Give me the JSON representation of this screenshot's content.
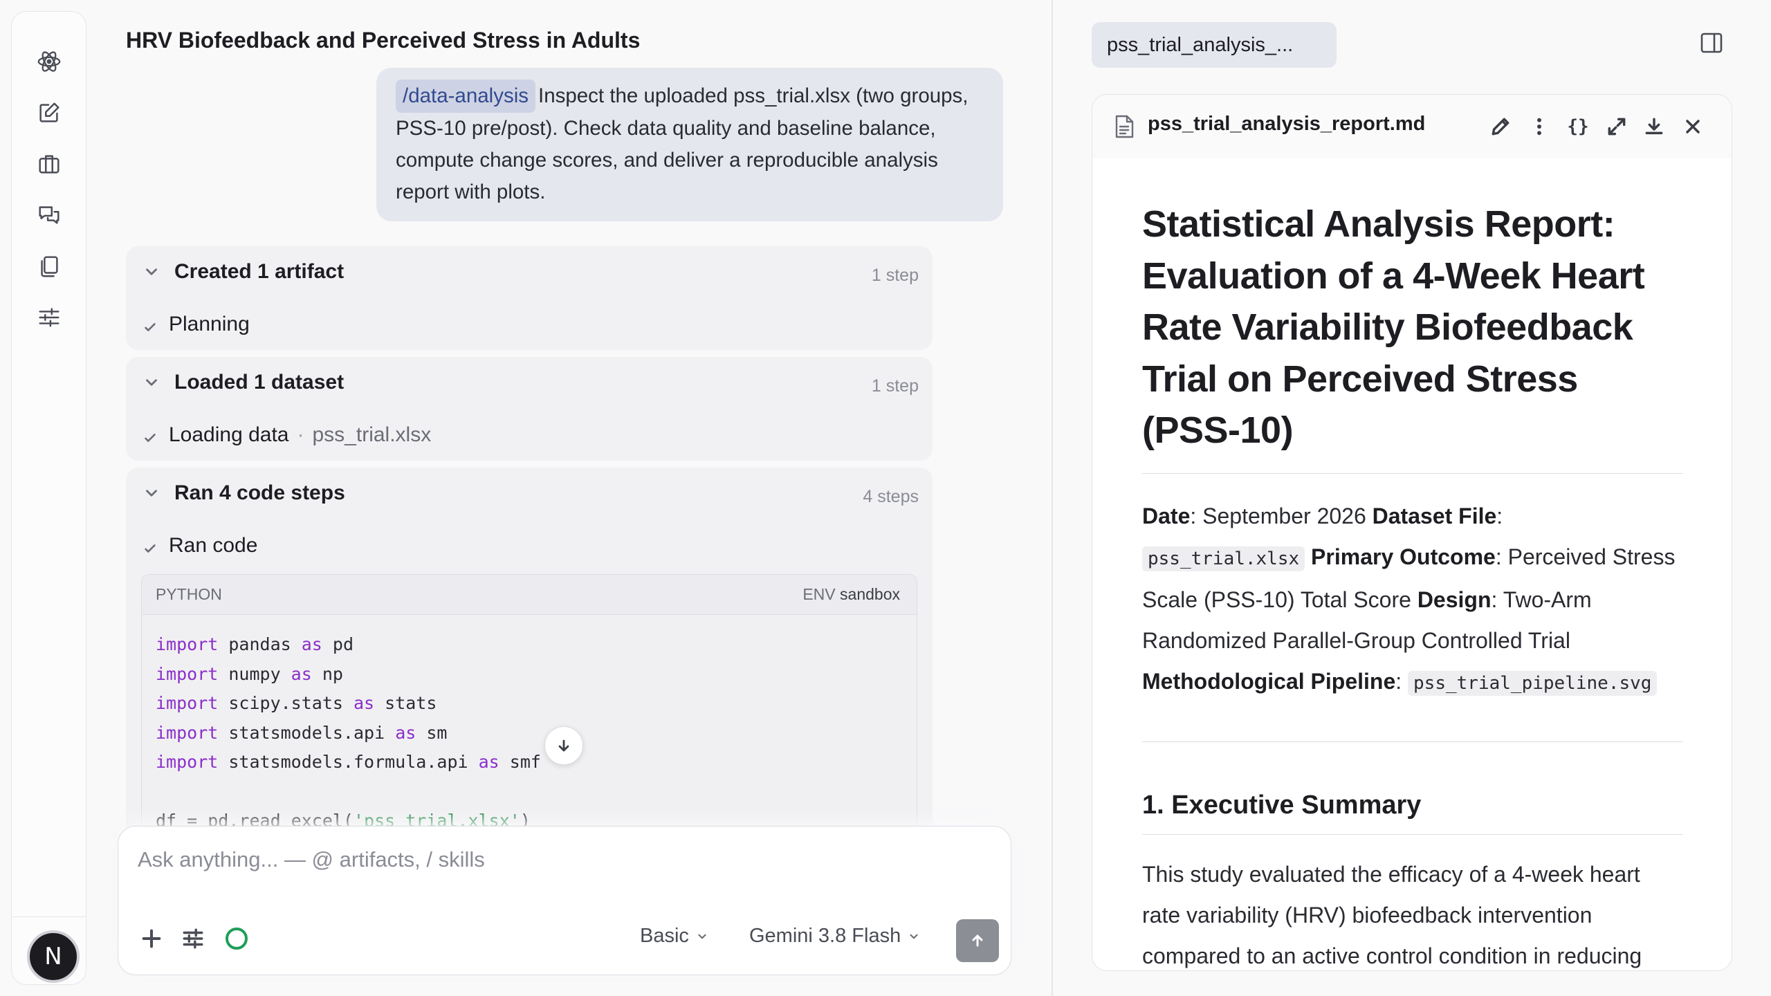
{
  "rail": {
    "icons": [
      "atom-logo-icon",
      "new-chat-icon",
      "briefcase-icon",
      "chats-icon",
      "copy-icon",
      "settings-sliders-icon"
    ],
    "avatar_letter": "N"
  },
  "chat": {
    "title": "HRV Biofeedback and Perceived Stress in Adults",
    "user_message": {
      "skill": "/data-analysis",
      "text": "Inspect the uploaded pss_trial.xlsx (two groups, PSS-10 pre/post). Check data quality and baseline balance, compute change scores, and deliver a reproducible analysis report with plots."
    },
    "groups": [
      {
        "title": "Created 1 artifact",
        "count": "1 step",
        "item": "Planning"
      },
      {
        "title": "Loaded 1 dataset",
        "count": "1 step",
        "item": "Loading data",
        "item_file": "pss_trial.xlsx",
        "separator": "·"
      },
      {
        "title": "Ran 4 code steps",
        "count": "4 steps",
        "item": "Ran code"
      }
    ],
    "code": {
      "language": "PYTHON",
      "env_label": "ENV",
      "env_value": "sandbox",
      "lines": [
        [
          [
            "kw",
            "import"
          ],
          [
            "t",
            " pandas "
          ],
          [
            "kw",
            "as"
          ],
          [
            "t",
            " pd"
          ]
        ],
        [
          [
            "kw",
            "import"
          ],
          [
            "t",
            " numpy "
          ],
          [
            "kw",
            "as"
          ],
          [
            "t",
            " np"
          ]
        ],
        [
          [
            "kw",
            "import"
          ],
          [
            "t",
            " scipy.stats "
          ],
          [
            "kw",
            "as"
          ],
          [
            "t",
            " stats"
          ]
        ],
        [
          [
            "kw",
            "import"
          ],
          [
            "t",
            " statsmodels.api "
          ],
          [
            "kw",
            "as"
          ],
          [
            "t",
            " sm"
          ]
        ],
        [
          [
            "kw",
            "import"
          ],
          [
            "t",
            " statsmodels.formula.api "
          ],
          [
            "kw",
            "as"
          ],
          [
            "t",
            " smf"
          ]
        ],
        [
          [
            "t",
            ""
          ]
        ],
        [
          [
            "t",
            "df = pd.read_excel("
          ],
          [
            "str",
            "'pss_trial.xlsx'"
          ],
          [
            "t",
            ")"
          ]
        ]
      ]
    }
  },
  "composer": {
    "placeholder": "Ask anything... — @ artifacts, / skills",
    "mode": "Basic",
    "model": "Gemini 3.8 Flash"
  },
  "artifact": {
    "tab_label": "pss_trial_analysis_...",
    "file_name": "pss_trial_analysis_report.md",
    "braces_label": "{}",
    "title": "Statistical Analysis Report: Evaluation of a 4-Week Heart Rate Variability Biofeedback Trial on Perceived Stress (PSS-10)",
    "meta": {
      "date_label": "Date",
      "date_value": ": September 2026 ",
      "dataset_label": "Dataset File",
      "dataset_sep": ":",
      "dataset_value": "pss_trial.xlsx",
      "outcome_label": "Primary Outcome",
      "outcome_value": ": Perceived Stress Scale (PSS-10) Total Score ",
      "design_label": "Design",
      "design_value": ": Two-Arm Randomized Parallel-Group Controlled Trial",
      "pipeline_label": "Methodological Pipeline",
      "pipeline_sep": ":",
      "pipeline_value": "pss_trial_pipeline.svg"
    },
    "section1_heading": "1. Executive Summary",
    "section1_text": "This study evaluated the efficacy of a 4-week heart rate variability (HRV) biofeedback intervention compared to an active control condition in reducing"
  },
  "colors": {
    "accent_chip_bg": "#cdd3e4",
    "accent_chip_text": "#33498f",
    "keyword": "#8b2fc9",
    "string": "#1f8a45",
    "status_green": "#1f9e5a"
  }
}
